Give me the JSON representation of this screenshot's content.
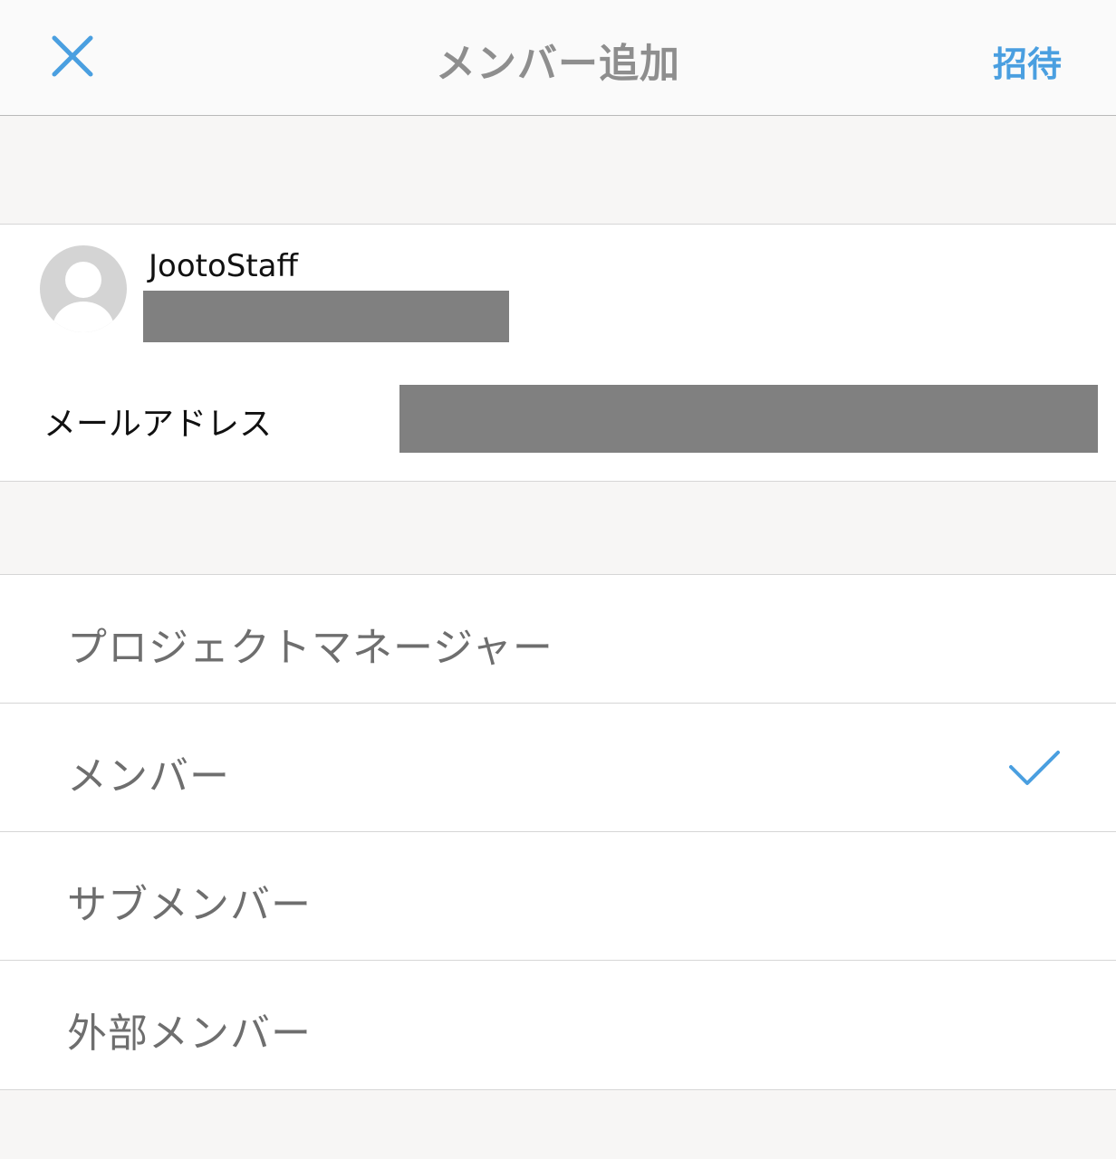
{
  "nav": {
    "title": "メンバー追加",
    "invite_label": "招待",
    "close_icon": "close-icon"
  },
  "user": {
    "name": "JootoStaff",
    "avatar_icon": "default-avatar-icon"
  },
  "email": {
    "label": "メールアドレス"
  },
  "roles": [
    {
      "label": "プロジェクトマネージャー",
      "selected": false
    },
    {
      "label": "メンバー",
      "selected": true
    },
    {
      "label": "サブメンバー",
      "selected": false
    },
    {
      "label": "外部メンバー",
      "selected": false
    }
  ],
  "colors": {
    "accent": "#4a9fe0",
    "title": "#8e8e8e",
    "role_text": "#6e6e6e",
    "background": "#f7f6f5",
    "redaction": "#808080"
  }
}
